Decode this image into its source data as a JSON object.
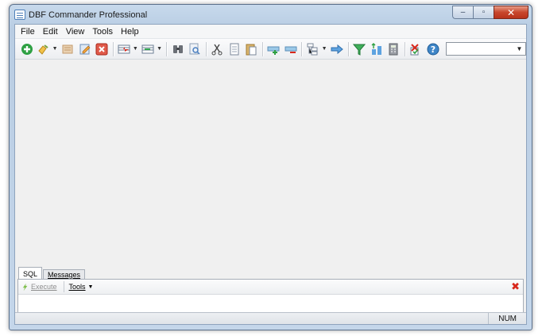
{
  "window": {
    "title": "DBF Commander Professional"
  },
  "caption": {
    "minimize": "–",
    "maximize": "▫",
    "close": "✕"
  },
  "menu": [
    "File",
    "Edit",
    "View",
    "Tools",
    "Help"
  ],
  "toolbar": {
    "icons": [
      "new-icon",
      "open-icon",
      "save-icon",
      "edit-icon",
      "delete-icon",
      "import-icon",
      "export-icon",
      "find-icon",
      "find-next-icon",
      "cut-icon",
      "copy-icon",
      "paste-icon",
      "add-record-icon",
      "delete-record-icon",
      "structure-icon",
      "goto-icon",
      "filter-icon",
      "sort-icon",
      "calculator-icon",
      "check-icon",
      "help-icon"
    ],
    "combo_value": ""
  },
  "panel": {
    "tabs": [
      "SQL",
      "Messages"
    ],
    "execute_label": "Execute",
    "tools_label": "Tools"
  },
  "status": {
    "num": "NUM"
  },
  "colors": {
    "accent": "#3f86c8",
    "close_red": "#d8281c"
  }
}
